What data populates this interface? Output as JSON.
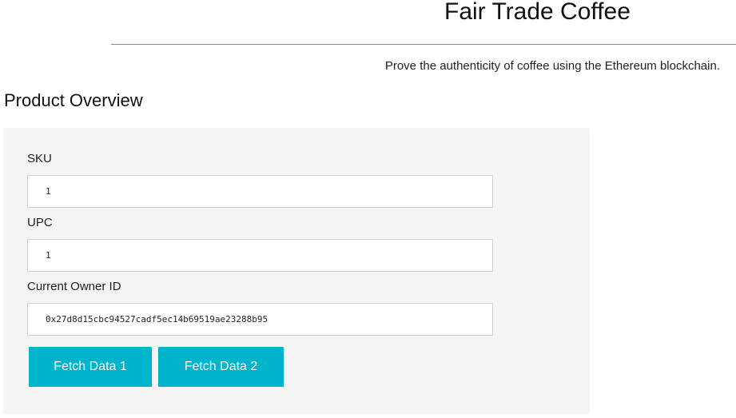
{
  "header": {
    "title": "Fair Trade Coffee",
    "tagline": "Prove the authenticity of coffee using the Ethereum blockchain."
  },
  "product_overview": {
    "heading": "Product Overview",
    "sku": {
      "label": "SKU",
      "value": "1"
    },
    "upc": {
      "label": "UPC",
      "value": "1"
    },
    "owner": {
      "label": "Current Owner ID",
      "value": "0x27d8d15cbc94527cadf5ec14b69519ae23288b95"
    },
    "buttons": {
      "fetch1": "Fetch Data 1",
      "fetch2": "Fetch Data 2"
    }
  },
  "colors": {
    "button_bg": "#00b4cc",
    "panel_bg": "#f5f5f5"
  }
}
